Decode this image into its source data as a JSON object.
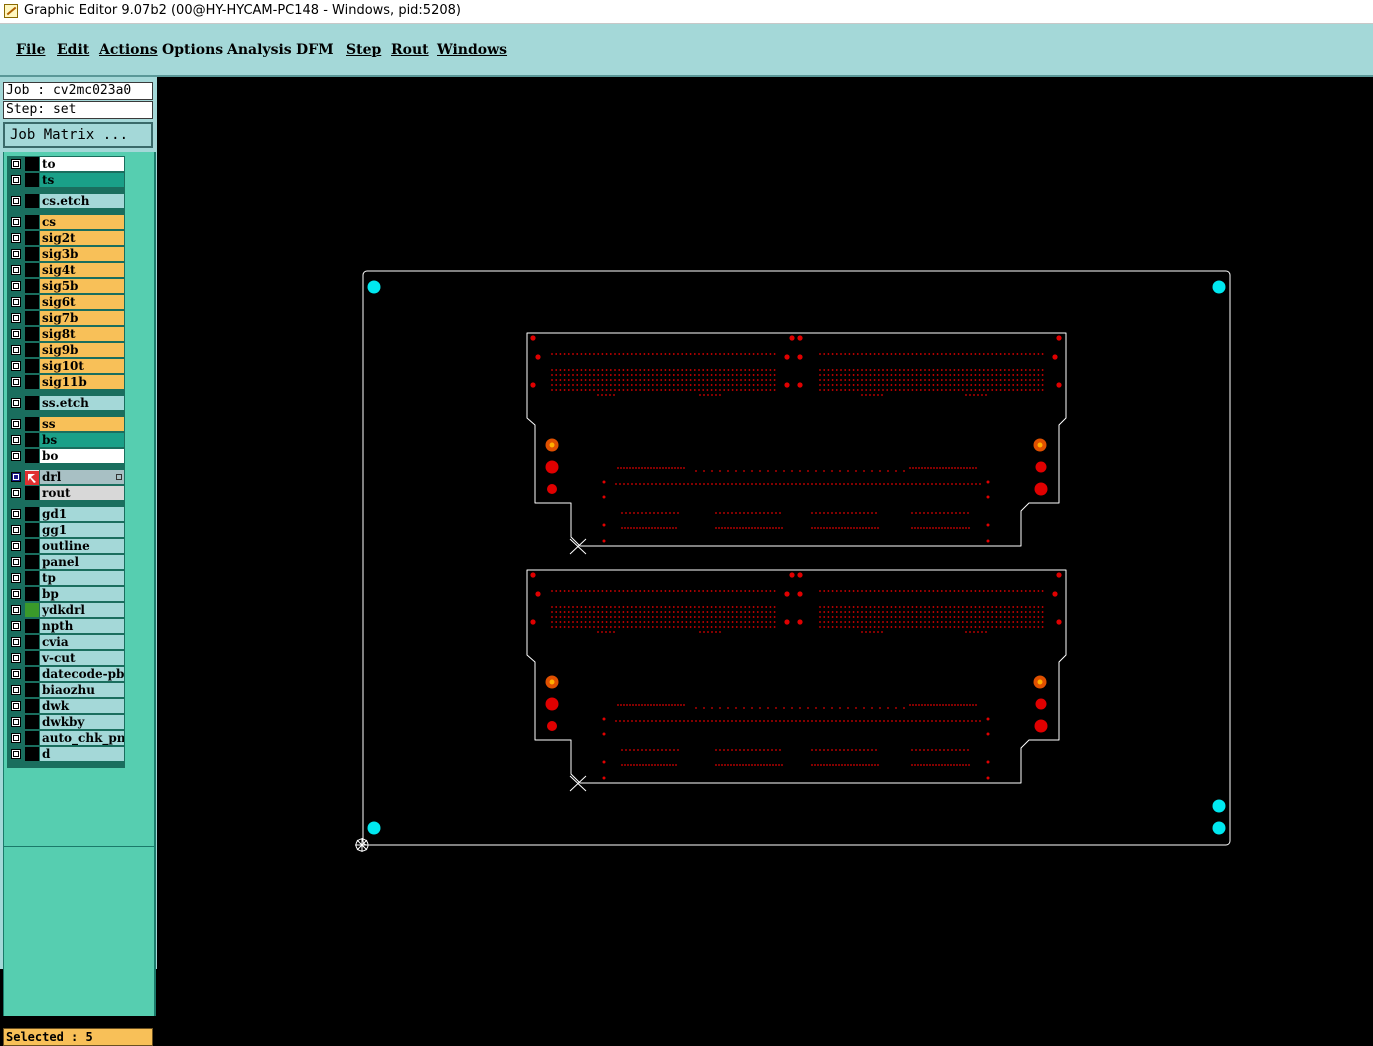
{
  "window": {
    "title": "Graphic Editor 9.07b2 (00@HY-HYCAM-PC148 - Windows, pid:5208)"
  },
  "menu": [
    {
      "label": "File"
    },
    {
      "label": "Edit"
    },
    {
      "label": "Actions"
    },
    {
      "label": "Options"
    },
    {
      "label": "Analysis"
    },
    {
      "label": "DFM"
    },
    {
      "label": "Step"
    },
    {
      "label": "Rout"
    },
    {
      "label": "Windows"
    }
  ],
  "job": {
    "job_line": "Job : cv2mc023a0",
    "step_line": "Step: set",
    "matrix_button": "Job Matrix ..."
  },
  "colors": {
    "silk": "#ffffff",
    "mask": "#1aa088",
    "inner_signal": "#f8c058",
    "signal_etch": "#a4d8d8",
    "drill": "#a8c0c4",
    "rout": "#d8d8d8",
    "misc": "#a4d8d8",
    "ydkdrl_swatch": "#3a9a2a",
    "board_features": "#e00000",
    "tooling_holes": "#00e8f0"
  },
  "layers": [
    {
      "name": "to",
      "group": "silk"
    },
    {
      "name": "ts",
      "group": "mask"
    },
    {
      "name": "cs.etch",
      "group": "signal_etch"
    },
    {
      "name": "cs",
      "group": "inner_signal"
    },
    {
      "name": "sig2t",
      "group": "inner_signal"
    },
    {
      "name": "sig3b",
      "group": "inner_signal"
    },
    {
      "name": "sig4t",
      "group": "inner_signal"
    },
    {
      "name": "sig5b",
      "group": "inner_signal"
    },
    {
      "name": "sig6t",
      "group": "inner_signal"
    },
    {
      "name": "sig7b",
      "group": "inner_signal"
    },
    {
      "name": "sig8t",
      "group": "inner_signal"
    },
    {
      "name": "sig9b",
      "group": "inner_signal"
    },
    {
      "name": "sig10t",
      "group": "inner_signal"
    },
    {
      "name": "sig11b",
      "group": "inner_signal"
    },
    {
      "name": "ss.etch",
      "group": "signal_etch"
    },
    {
      "name": "ss",
      "group": "inner_signal"
    },
    {
      "name": "bs",
      "group": "mask"
    },
    {
      "name": "bo",
      "group": "silk"
    },
    {
      "name": "drl",
      "group": "drill",
      "active": true
    },
    {
      "name": "rout",
      "group": "rout"
    },
    {
      "name": "gd1",
      "group": "misc"
    },
    {
      "name": "gg1",
      "group": "misc"
    },
    {
      "name": "outline",
      "group": "misc"
    },
    {
      "name": "panel",
      "group": "misc"
    },
    {
      "name": "tp",
      "group": "misc"
    },
    {
      "name": "bp",
      "group": "misc"
    },
    {
      "name": "ydkdrl",
      "group": "misc",
      "swatch": true
    },
    {
      "name": "npth",
      "group": "misc"
    },
    {
      "name": "cvia",
      "group": "misc"
    },
    {
      "name": "v-cut",
      "group": "misc"
    },
    {
      "name": "datecode-pbe",
      "group": "misc"
    },
    {
      "name": "biaozhu",
      "group": "misc"
    },
    {
      "name": "dwk",
      "group": "misc"
    },
    {
      "name": "dwkby",
      "group": "misc"
    },
    {
      "name": "auto_chk_pnl",
      "group": "misc"
    },
    {
      "name": "d",
      "group": "misc"
    }
  ],
  "status": {
    "selected": "Selected : 5"
  }
}
